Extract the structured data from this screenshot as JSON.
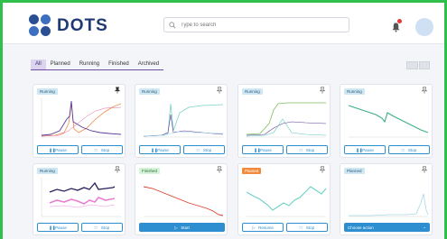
{
  "app": {
    "brand": "DOTS"
  },
  "search": {
    "placeholder": "Type to search"
  },
  "tabs": [
    {
      "label": "All",
      "active": true
    },
    {
      "label": "Planned"
    },
    {
      "label": "Running"
    },
    {
      "label": "Finished"
    },
    {
      "label": "Archived"
    }
  ],
  "cards": [
    {
      "status": "Running",
      "actions": [
        "Pause",
        "Stop"
      ]
    },
    {
      "status": "Running",
      "actions": [
        "Pause",
        "Stop"
      ]
    },
    {
      "status": "Running",
      "actions": [
        "Pause",
        "Stop"
      ]
    },
    {
      "status": "Running",
      "actions": [
        "Pause",
        "Stop"
      ]
    },
    {
      "status": "Running",
      "actions": [
        "Pause",
        "Stop"
      ]
    },
    {
      "status": "Finished",
      "actions": [
        "Start"
      ]
    },
    {
      "status": "Paused",
      "actions": [
        "Resume",
        "Stop"
      ]
    },
    {
      "status": "Planned",
      "actions": [
        "Choose action"
      ]
    }
  ],
  "colors": {
    "accent": "#2d8fd0",
    "brand": "#1f3a73",
    "frame": "#2fbf4a",
    "tab_active_bg": "#dcd4ee",
    "paused_badge": "#f28a3c"
  }
}
